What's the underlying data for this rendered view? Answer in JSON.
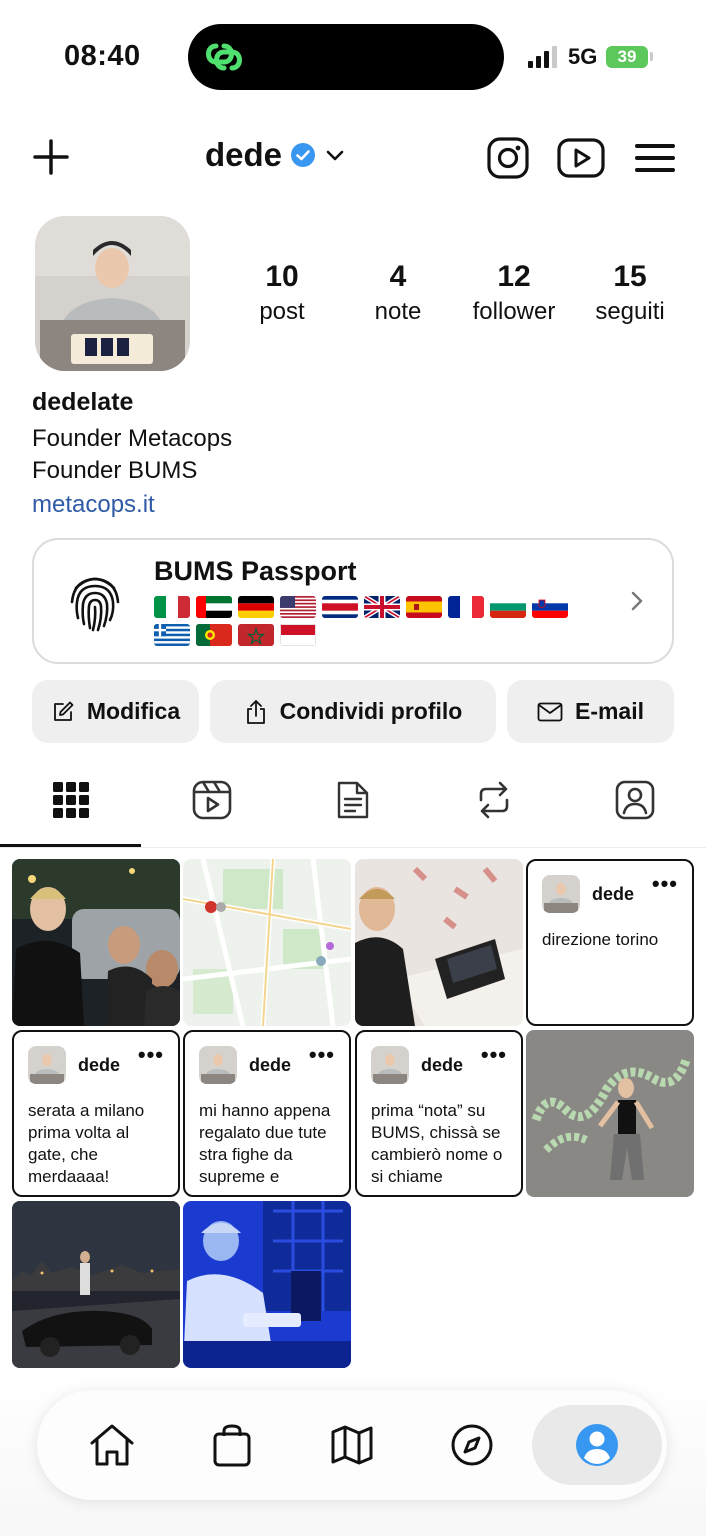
{
  "status": {
    "time": "08:40",
    "network": "5G",
    "battery": "39"
  },
  "header": {
    "username": "dede"
  },
  "profile": {
    "stats": [
      {
        "value": "10",
        "label": "post"
      },
      {
        "value": "4",
        "label": "note"
      },
      {
        "value": "12",
        "label": "follower"
      },
      {
        "value": "15",
        "label": "seguiti"
      }
    ],
    "name": "dedelate",
    "bio": [
      "Founder Metacops",
      "Founder BUMS"
    ],
    "link": "metacops.it"
  },
  "passport": {
    "title": "BUMS Passport",
    "flags": [
      "italy",
      "uae",
      "germany",
      "usa",
      "costa-rica",
      "uk",
      "spain",
      "france",
      "bulgaria",
      "slovenia",
      "greece",
      "portugal",
      "morocco",
      "indonesia"
    ]
  },
  "actions": {
    "edit": "Modifica",
    "share": "Condividi profilo",
    "email": "E-mail"
  },
  "tabs": [
    "grid",
    "reels",
    "notes",
    "reposts",
    "tagged"
  ],
  "notes": [
    {
      "user": "dede",
      "text": "direzione torino"
    },
    {
      "user": "dede",
      "text": "serata a milano prima volta al gate, che merdaaaa!"
    },
    {
      "user": "dede",
      "text": "mi hanno appena regalato due tute stra fighe da supreme e"
    },
    {
      "user": "dede",
      "text": "prima “nota” su BUMS, chissà se cambierò nome o si chiame"
    }
  ],
  "colors": {
    "link": "#2f5aa5",
    "verified": "#3897f0",
    "accent_green": "#5cc85c"
  }
}
